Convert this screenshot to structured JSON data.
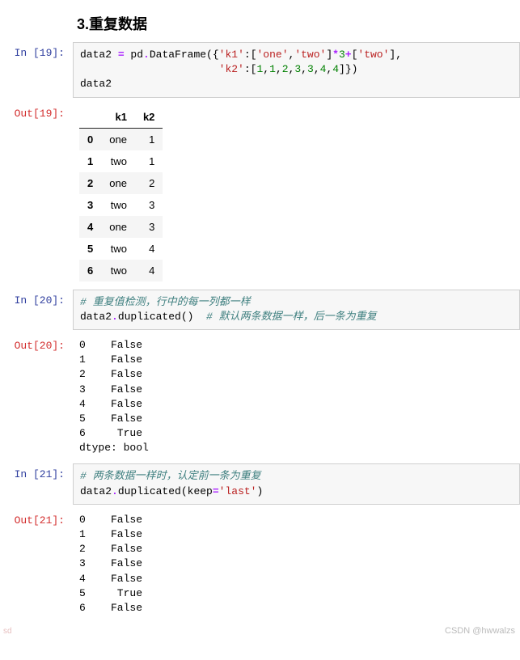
{
  "heading": "3.重复数据",
  "cells": {
    "c19": {
      "in_prompt": "In  [19]:",
      "out_prompt": "Out[19]:",
      "code_tokens": [
        {
          "t": "data2 ",
          "c": ""
        },
        {
          "t": "=",
          "c": "tok-op"
        },
        {
          "t": " pd",
          "c": ""
        },
        {
          "t": ".",
          "c": "tok-op"
        },
        {
          "t": "DataFrame({",
          "c": ""
        },
        {
          "t": "'k1'",
          "c": "tok-str"
        },
        {
          "t": ":[",
          "c": ""
        },
        {
          "t": "'one'",
          "c": "tok-str"
        },
        {
          "t": ",",
          "c": ""
        },
        {
          "t": "'two'",
          "c": "tok-str"
        },
        {
          "t": "]",
          "c": ""
        },
        {
          "t": "*",
          "c": "tok-op"
        },
        {
          "t": "3",
          "c": "tok-num"
        },
        {
          "t": "+",
          "c": "tok-op"
        },
        {
          "t": "[",
          "c": ""
        },
        {
          "t": "'two'",
          "c": "tok-str"
        },
        {
          "t": "],",
          "c": ""
        },
        {
          "t": "\n                      ",
          "c": ""
        },
        {
          "t": "'k2'",
          "c": "tok-str"
        },
        {
          "t": ":[",
          "c": ""
        },
        {
          "t": "1",
          "c": "tok-num"
        },
        {
          "t": ",",
          "c": ""
        },
        {
          "t": "1",
          "c": "tok-num"
        },
        {
          "t": ",",
          "c": ""
        },
        {
          "t": "2",
          "c": "tok-num"
        },
        {
          "t": ",",
          "c": ""
        },
        {
          "t": "3",
          "c": "tok-num"
        },
        {
          "t": ",",
          "c": ""
        },
        {
          "t": "3",
          "c": "tok-num"
        },
        {
          "t": ",",
          "c": ""
        },
        {
          "t": "4",
          "c": "tok-num"
        },
        {
          "t": ",",
          "c": ""
        },
        {
          "t": "4",
          "c": "tok-num"
        },
        {
          "t": "]})\n",
          "c": ""
        },
        {
          "t": "data2",
          "c": ""
        }
      ],
      "table": {
        "columns": [
          "k1",
          "k2"
        ],
        "index": [
          "0",
          "1",
          "2",
          "3",
          "4",
          "5",
          "6"
        ],
        "rows": [
          [
            "one",
            "1"
          ],
          [
            "two",
            "1"
          ],
          [
            "one",
            "2"
          ],
          [
            "two",
            "3"
          ],
          [
            "one",
            "3"
          ],
          [
            "two",
            "4"
          ],
          [
            "two",
            "4"
          ]
        ]
      }
    },
    "c20": {
      "in_prompt": "In  [20]:",
      "out_prompt": "Out[20]:",
      "code_tokens": [
        {
          "t": "# 重复值检测，行中的每一列都一样",
          "c": "tok-cmt"
        },
        {
          "t": "\n",
          "c": ""
        },
        {
          "t": "data2",
          "c": ""
        },
        {
          "t": ".",
          "c": "tok-op"
        },
        {
          "t": "duplicated()  ",
          "c": ""
        },
        {
          "t": "# 默认两条数据一样，后一条为重复",
          "c": "tok-cmt"
        }
      ],
      "output_text": "0    False\n1    False\n2    False\n3    False\n4    False\n5    False\n6     True\ndtype: bool"
    },
    "c21": {
      "in_prompt": "In  [21]:",
      "out_prompt": "Out[21]:",
      "code_tokens": [
        {
          "t": "# 两条数据一样时，认定前一条为重复",
          "c": "tok-cmt"
        },
        {
          "t": "\n",
          "c": ""
        },
        {
          "t": "data2",
          "c": ""
        },
        {
          "t": ".",
          "c": "tok-op"
        },
        {
          "t": "duplicated(keep",
          "c": ""
        },
        {
          "t": "=",
          "c": "tok-op"
        },
        {
          "t": "'last'",
          "c": "tok-str"
        },
        {
          "t": ")",
          "c": ""
        }
      ],
      "output_text": "0    False\n1    False\n2    False\n3    False\n4    False\n5     True\n6    False"
    }
  },
  "watermarks": {
    "right": "CSDN @hwwalzs",
    "left": "sd"
  }
}
